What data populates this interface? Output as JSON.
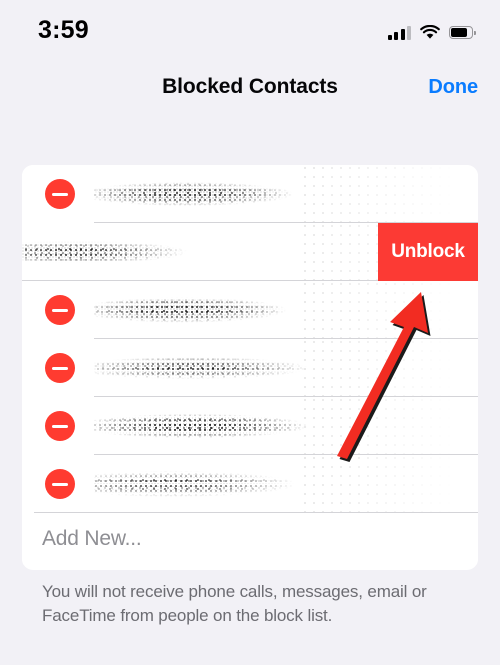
{
  "statusbar": {
    "time": "3:59",
    "cellular_icon": "cellular-bars-icon",
    "wifi_icon": "wifi-icon",
    "battery_icon": "battery-icon",
    "battery_level": 75
  },
  "navbar": {
    "title": "Blocked Contacts",
    "done_label": "Done",
    "accent_color": "#0A7CFF"
  },
  "list": {
    "rows": [
      {
        "name": "",
        "redacted": true,
        "delete_icon": "minus-circle-icon",
        "swiped": false
      },
      {
        "name": "",
        "redacted": true,
        "delete_icon": "minus-circle-icon",
        "swiped": true
      },
      {
        "name": "",
        "redacted": true,
        "delete_icon": "minus-circle-icon",
        "swiped": false
      },
      {
        "name": "",
        "redacted": true,
        "delete_icon": "minus-circle-icon",
        "swiped": false
      },
      {
        "name": "",
        "redacted": true,
        "delete_icon": "minus-circle-icon",
        "swiped": false
      },
      {
        "name": "",
        "redacted": true,
        "delete_icon": "minus-circle-icon",
        "swiped": false
      }
    ],
    "swipe_action_label": "Unblock",
    "swipe_action_color": "#FC3A34",
    "delete_button_color": "#FF3B30",
    "add_new_label": "Add New..."
  },
  "footer": {
    "text": "You will not receive phone calls, messages, email or FaceTime from people on the block list."
  },
  "annotation": {
    "arrow_icon": "pointer-arrow-icon",
    "arrow_color": "#F22C22",
    "points_to": "Unblock"
  }
}
